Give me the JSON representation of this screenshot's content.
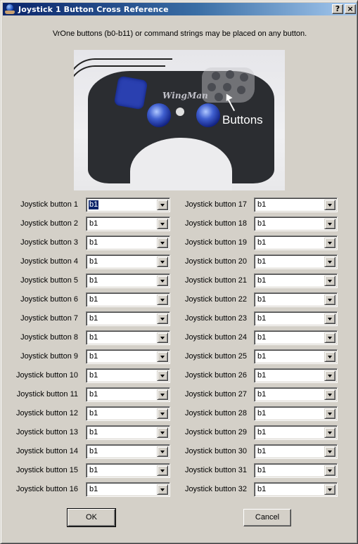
{
  "window": {
    "title": "Joystick 1 Button Cross Reference",
    "help_button": "?",
    "close_button": "×"
  },
  "instructions": "VrOne buttons (b0-b11) or command strings may be placed on any button.",
  "photo": {
    "brand_text": "WingMan",
    "annotation": "Buttons",
    "alt": "Logitech WingMan gamepad"
  },
  "left_column": [
    {
      "label": "Joystick button 1",
      "value": "b1"
    },
    {
      "label": "Joystick button 2",
      "value": "b1"
    },
    {
      "label": "Joystick button 3",
      "value": "b1"
    },
    {
      "label": "Joystick button 4",
      "value": "b1"
    },
    {
      "label": "Joystick button 5",
      "value": "b1"
    },
    {
      "label": "Joystick button 6",
      "value": "b1"
    },
    {
      "label": "Joystick button 7",
      "value": "b1"
    },
    {
      "label": "Joystick button 8",
      "value": "b1"
    },
    {
      "label": "Joystick button 9",
      "value": "b1"
    },
    {
      "label": "Joystick button 10",
      "value": "b1"
    },
    {
      "label": "Joystick button 11",
      "value": "b1"
    },
    {
      "label": "Joystick button 12",
      "value": "b1"
    },
    {
      "label": "Joystick button 13",
      "value": "b1"
    },
    {
      "label": "Joystick button 14",
      "value": "b1"
    },
    {
      "label": "Joystick button 15",
      "value": "b1"
    },
    {
      "label": "Joystick button 16",
      "value": "b1"
    }
  ],
  "right_column": [
    {
      "label": "Joystick button 17",
      "value": "b1"
    },
    {
      "label": "Joystick button 18",
      "value": "b1"
    },
    {
      "label": "Joystick button 19",
      "value": "b1"
    },
    {
      "label": "Joystick button 20",
      "value": "b1"
    },
    {
      "label": "Joystick button 21",
      "value": "b1"
    },
    {
      "label": "Joystick button 22",
      "value": "b1"
    },
    {
      "label": "Joystick button 23",
      "value": "b1"
    },
    {
      "label": "Joystick button 24",
      "value": "b1"
    },
    {
      "label": "Joystick button 25",
      "value": "b1"
    },
    {
      "label": "Joystick button 26",
      "value": "b1"
    },
    {
      "label": "Joystick button 27",
      "value": "b1"
    },
    {
      "label": "Joystick button 28",
      "value": "b1"
    },
    {
      "label": "Joystick button 29",
      "value": "b1"
    },
    {
      "label": "Joystick button 30",
      "value": "b1"
    },
    {
      "label": "Joystick button 31",
      "value": "b1"
    },
    {
      "label": "Joystick button 32",
      "value": "b1"
    }
  ],
  "selected_field": "left_column.0",
  "buttons": {
    "ok": "OK",
    "cancel": "Cancel"
  }
}
